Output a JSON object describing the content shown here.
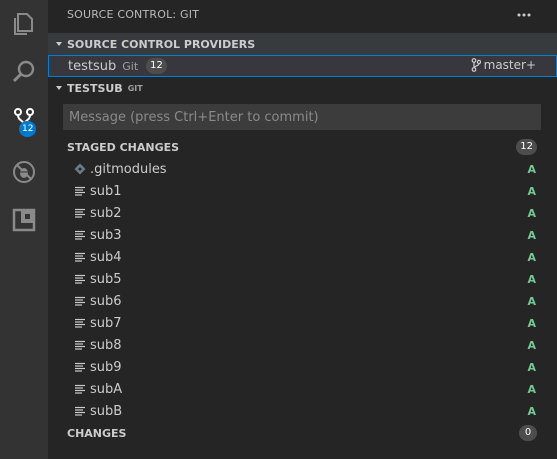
{
  "activity_bar": {
    "items": [
      {
        "icon": "files-icon"
      },
      {
        "icon": "search-icon"
      },
      {
        "icon": "source-control-icon",
        "badge": "12"
      },
      {
        "icon": "debug-icon"
      },
      {
        "icon": "extensions-icon"
      }
    ],
    "accent_color": "#007acc"
  },
  "sidebar": {
    "title": "SOURCE CONTROL: GIT",
    "more_icon": "ellipsis-icon"
  },
  "providers": {
    "header": "SOURCE CONTROL PROVIDERS",
    "row": {
      "name": "testsub",
      "type": "Git",
      "count": "12",
      "branch": "master+"
    }
  },
  "repo": {
    "header": "TESTSUB",
    "sub": "GIT",
    "message_placeholder": "Message (press Ctrl+Enter to commit)",
    "message_value": ""
  },
  "staged": {
    "label": "STAGED CHANGES",
    "count": "12",
    "files": [
      {
        "name": ".gitmodules",
        "status": "A",
        "icon": "gitmodules-file-icon"
      },
      {
        "name": "sub1",
        "status": "A",
        "icon": "lines-file-icon"
      },
      {
        "name": "sub2",
        "status": "A",
        "icon": "lines-file-icon"
      },
      {
        "name": "sub3",
        "status": "A",
        "icon": "lines-file-icon"
      },
      {
        "name": "sub4",
        "status": "A",
        "icon": "lines-file-icon"
      },
      {
        "name": "sub5",
        "status": "A",
        "icon": "lines-file-icon"
      },
      {
        "name": "sub6",
        "status": "A",
        "icon": "lines-file-icon"
      },
      {
        "name": "sub7",
        "status": "A",
        "icon": "lines-file-icon"
      },
      {
        "name": "sub8",
        "status": "A",
        "icon": "lines-file-icon"
      },
      {
        "name": "sub9",
        "status": "A",
        "icon": "lines-file-icon"
      },
      {
        "name": "subA",
        "status": "A",
        "icon": "lines-file-icon"
      },
      {
        "name": "subB",
        "status": "A",
        "icon": "lines-file-icon"
      }
    ]
  },
  "changes": {
    "label": "CHANGES",
    "count": "0"
  },
  "colors": {
    "added": "#73c991",
    "focus_border": "#007fd4"
  }
}
